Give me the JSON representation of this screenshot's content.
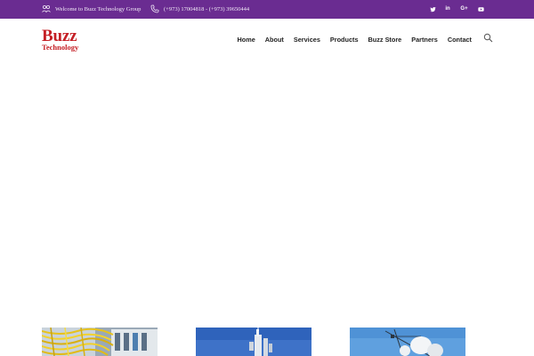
{
  "topbar": {
    "welcome_text": "Welcome to Buzz Technology Group",
    "phone_text": "(+973) 17004818 - (+973) 39650444",
    "welcome_icon": "team-icon",
    "phone_icon": "phone-icon",
    "social": [
      {
        "name": "twitter-icon",
        "glyph": "t"
      },
      {
        "name": "linkedin-icon",
        "glyph": "in"
      },
      {
        "name": "google-plus-icon",
        "glyph": "G+"
      },
      {
        "name": "youtube-icon",
        "glyph": "▶"
      }
    ],
    "background_color": "#6a2c91"
  },
  "header": {
    "logo": {
      "line1": "Buzz",
      "line2": "Technology",
      "color": "#c52026"
    },
    "nav": [
      "Home",
      "About",
      "Services",
      "Products",
      "Buzz Store",
      "Partners",
      "Contact"
    ],
    "search_icon": "search-icon"
  },
  "cards": [
    {
      "name": "network-cables-image"
    },
    {
      "name": "antenna-tower-image"
    },
    {
      "name": "satellite-dish-image"
    }
  ]
}
